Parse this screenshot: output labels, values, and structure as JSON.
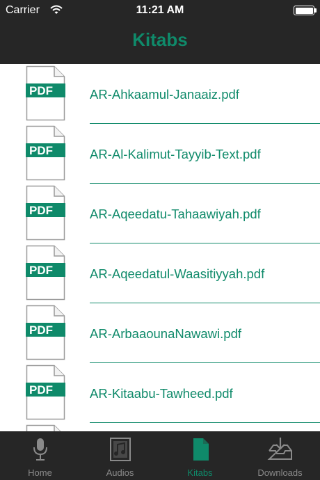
{
  "status_bar": {
    "carrier": "Carrier",
    "time": "11:21 AM"
  },
  "nav": {
    "title": "Kitabs"
  },
  "pdf_badge": "PDF",
  "files": [
    "AR-Ahkaamul-Janaaiz.pdf",
    "AR-Al-Kalimut-Tayyib-Text.pdf",
    "AR-Aqeedatu-Tahaawiyah.pdf",
    "AR-Aqeedatul-Waasitiyyah.pdf",
    "AR-ArbaaounaNawawi.pdf",
    "AR-Kitaabu-Tawheed.pdf"
  ],
  "tabs": [
    {
      "label": "Home",
      "icon": "microphone-icon",
      "active": false
    },
    {
      "label": "Audios",
      "icon": "music-note-icon",
      "active": false
    },
    {
      "label": "Kitabs",
      "icon": "document-icon",
      "active": true
    },
    {
      "label": "Downloads",
      "icon": "download-tray-icon",
      "active": false
    }
  ],
  "colors": {
    "accent": "#0f8a6a",
    "bar_bg": "#262626",
    "inactive": "#8a8a8a"
  }
}
